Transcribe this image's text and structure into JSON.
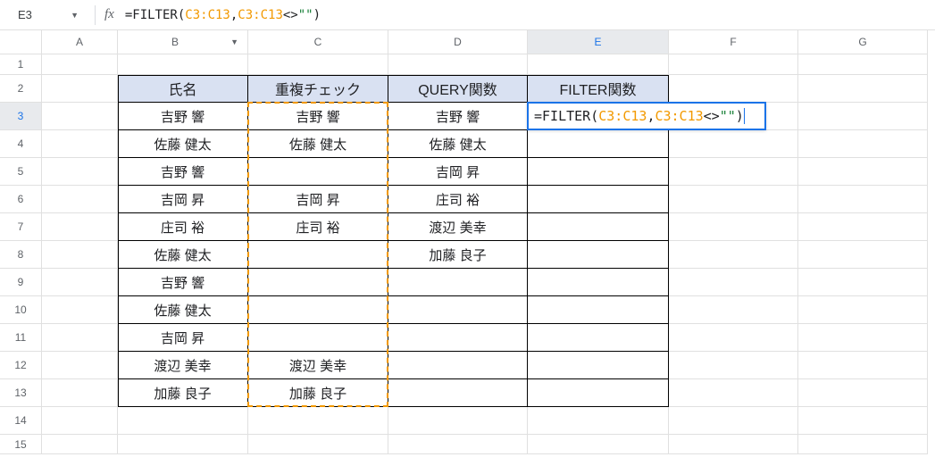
{
  "name_box": "E3",
  "formula": {
    "raw": "=FILTER(C3:C13,C3:C13<>\"\")",
    "parts": {
      "eq": "=",
      "fn": "FILTER",
      "open": "(",
      "ref_a": "C3:C13",
      "comma": ",",
      "ref_b": "C3:C13",
      "op": "<>",
      "str": "\"\"",
      "close": ")"
    }
  },
  "columns": [
    "A",
    "B",
    "C",
    "D",
    "E",
    "F",
    "G"
  ],
  "col_widths": {
    "A": 85,
    "B": 146,
    "C": 157,
    "D": 156,
    "E": 158,
    "F": 145,
    "G": 145
  },
  "rows": [
    1,
    2,
    3,
    4,
    5,
    6,
    7,
    8,
    9,
    10,
    11,
    12,
    13,
    14,
    15
  ],
  "selected_cell": {
    "row": 3,
    "col": "E"
  },
  "headers": {
    "B2": "氏名",
    "C2": "重複チェック",
    "D2": "QUERY関数",
    "E2": "FILTER関数"
  },
  "data": {
    "B": {
      "3": "吉野 響",
      "4": "佐藤 健太",
      "5": "吉野 響",
      "6": "吉岡 昇",
      "7": "庄司 裕",
      "8": "佐藤 健太",
      "9": "吉野 響",
      "10": "佐藤 健太",
      "11": "吉岡 昇",
      "12": "渡辺 美幸",
      "13": "加藤 良子"
    },
    "C": {
      "3": "吉野 響",
      "4": "佐藤 健太",
      "6": "吉岡 昇",
      "7": "庄司 裕",
      "12": "渡辺 美幸",
      "13": "加藤 良子"
    },
    "D": {
      "3": "吉野 響",
      "4": "佐藤 健太",
      "5": "吉岡 昇",
      "6": "庄司 裕",
      "7": "渡辺 美幸",
      "8": "加藤 良子"
    }
  },
  "edit_overlay": {
    "text_parts": {
      "pre": "=FILTER(",
      "ref_a": "C3:C13",
      "mid": ",",
      "ref_b": "C3:C13",
      "op": "<>",
      "str": "\"\"",
      "close": ")"
    }
  },
  "dashed_range": "C3:C13"
}
